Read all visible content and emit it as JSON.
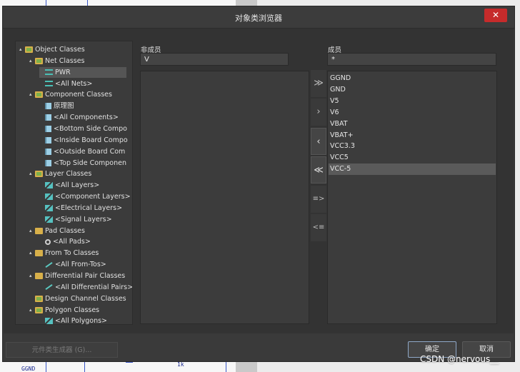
{
  "dialog": {
    "title": "对象类浏览器",
    "close_icon": "close-icon"
  },
  "tree": {
    "rows": [
      {
        "label": "Object Classes",
        "icon": "folder-open-icon",
        "toggle": "▴"
      },
      {
        "label": "Net Classes",
        "icon": "folder-open-icon",
        "toggle": "▴"
      },
      {
        "label": "PWR",
        "icon": "net-class-icon",
        "toggle": ""
      },
      {
        "label": "<All Nets>",
        "icon": "net-class-icon",
        "toggle": ""
      },
      {
        "label": "Component Classes",
        "icon": "folder-open-icon",
        "toggle": "▴"
      },
      {
        "label": "原理图",
        "icon": "component-class-icon",
        "toggle": ""
      },
      {
        "label": "<All Components>",
        "icon": "component-class-icon",
        "toggle": ""
      },
      {
        "label": "<Bottom Side Compo",
        "icon": "component-class-icon",
        "toggle": ""
      },
      {
        "label": "<Inside Board Compo",
        "icon": "component-class-icon",
        "toggle": ""
      },
      {
        "label": "<Outside Board Com",
        "icon": "component-class-icon",
        "toggle": ""
      },
      {
        "label": "<Top Side Componen",
        "icon": "component-class-icon",
        "toggle": ""
      },
      {
        "label": "Layer Classes",
        "icon": "folder-open-icon",
        "toggle": "▴"
      },
      {
        "label": "<All Layers>",
        "icon": "layer-class-icon",
        "toggle": ""
      },
      {
        "label": "<Component Layers>",
        "icon": "layer-class-icon",
        "toggle": ""
      },
      {
        "label": "<Electrical Layers>",
        "icon": "layer-class-icon",
        "toggle": ""
      },
      {
        "label": "<Signal Layers>",
        "icon": "layer-class-icon",
        "toggle": ""
      },
      {
        "label": "Pad Classes",
        "icon": "folder-icon",
        "toggle": "▴"
      },
      {
        "label": "<All Pads>",
        "icon": "pad-class-icon",
        "toggle": ""
      },
      {
        "label": "From To Classes",
        "icon": "folder-icon",
        "toggle": "▴"
      },
      {
        "label": "<All From-Tos>",
        "icon": "from-to-class-icon",
        "toggle": ""
      },
      {
        "label": "Differential Pair Classes",
        "icon": "folder-icon",
        "toggle": "▴"
      },
      {
        "label": "<All Differential Pairs>",
        "icon": "from-to-class-icon",
        "toggle": ""
      },
      {
        "label": "Design Channel Classes",
        "icon": "folder-open-icon",
        "toggle": ""
      },
      {
        "label": "Polygon Classes",
        "icon": "folder-open-icon",
        "toggle": "▴"
      },
      {
        "label": "<All Polygons>",
        "icon": "layer-class-icon",
        "toggle": ""
      }
    ],
    "selected": "PWR"
  },
  "non_members": {
    "label": "非成员",
    "filter": "V",
    "items": []
  },
  "members": {
    "label": "成员",
    "filter": "*",
    "items": [
      "GGND",
      "GND",
      "V5",
      "V6",
      "VBAT",
      "VBAT+",
      "VCC3.3",
      "VCC5",
      "VCC-5"
    ],
    "selected": "VCC-5"
  },
  "transfer_buttons": {
    "add_all": "≫",
    "add": "›",
    "remove": "‹",
    "remove_all": "≪",
    "add_selected_to_class": "≡>",
    "remove_to_list": "<≡"
  },
  "footer": {
    "generator_button": "元件类生成器 (G)...",
    "ok_button": "确定",
    "cancel_button": "取消",
    "watermark": "CSDN @nervous__"
  },
  "background": {
    "schematic_labels": [
      "GGND",
      "1k"
    ]
  },
  "colors": {
    "dialog_bg": "#3a3a3a",
    "close_button": "#c62b2b",
    "selection": "#555555"
  }
}
